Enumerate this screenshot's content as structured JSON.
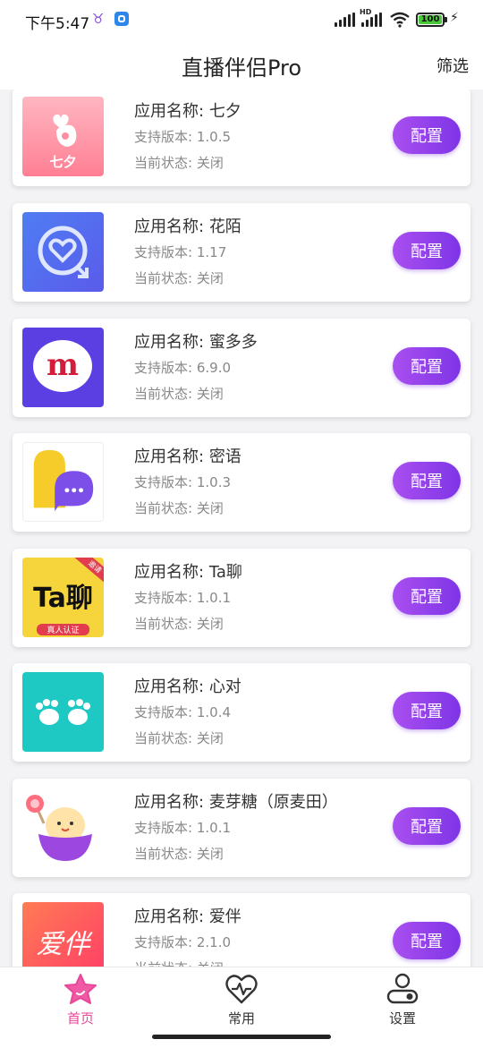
{
  "status_bar": {
    "time": "下午5:47",
    "hd": "HD",
    "battery": "100",
    "accent": "#49c93a"
  },
  "header": {
    "title": "直播伴侣Pro",
    "filter_label": "筛选"
  },
  "labels": {
    "name_prefix": "应用名称:",
    "version_prefix": "支持版本:",
    "state_prefix": "当前状态:",
    "config_button": "配置"
  },
  "apps": [
    {
      "icon_text": "七夕",
      "name": "七夕",
      "version": "1.0.5",
      "state": "关闭"
    },
    {
      "name": "花陌",
      "version": "1.17",
      "state": "关闭"
    },
    {
      "icon_text": "m",
      "name": "蜜多多",
      "version": "6.9.0",
      "state": "关闭"
    },
    {
      "name": "密语",
      "version": "1.0.3",
      "state": "关闭"
    },
    {
      "icon_text": "Ta聊",
      "icon_corner": "邀请",
      "icon_ribbon": "真人认证",
      "name": "Ta聊",
      "version": "1.0.1",
      "state": "关闭"
    },
    {
      "name": "心对",
      "version": "1.0.4",
      "state": "关闭"
    },
    {
      "name": "麦芽糖（原麦田）",
      "version": "1.0.1",
      "state": "关闭"
    },
    {
      "icon_text": "爱伴",
      "name": "爱伴",
      "version": "2.1.0",
      "state": "关闭"
    }
  ],
  "nav": [
    {
      "label": "首页",
      "icon": "star-icon",
      "active": true,
      "color": "#e8469a"
    },
    {
      "label": "常用",
      "icon": "heart-pulse-icon",
      "active": false,
      "color": "#333333"
    },
    {
      "label": "设置",
      "icon": "user-toggle-icon",
      "active": false,
      "color": "#333333"
    }
  ]
}
